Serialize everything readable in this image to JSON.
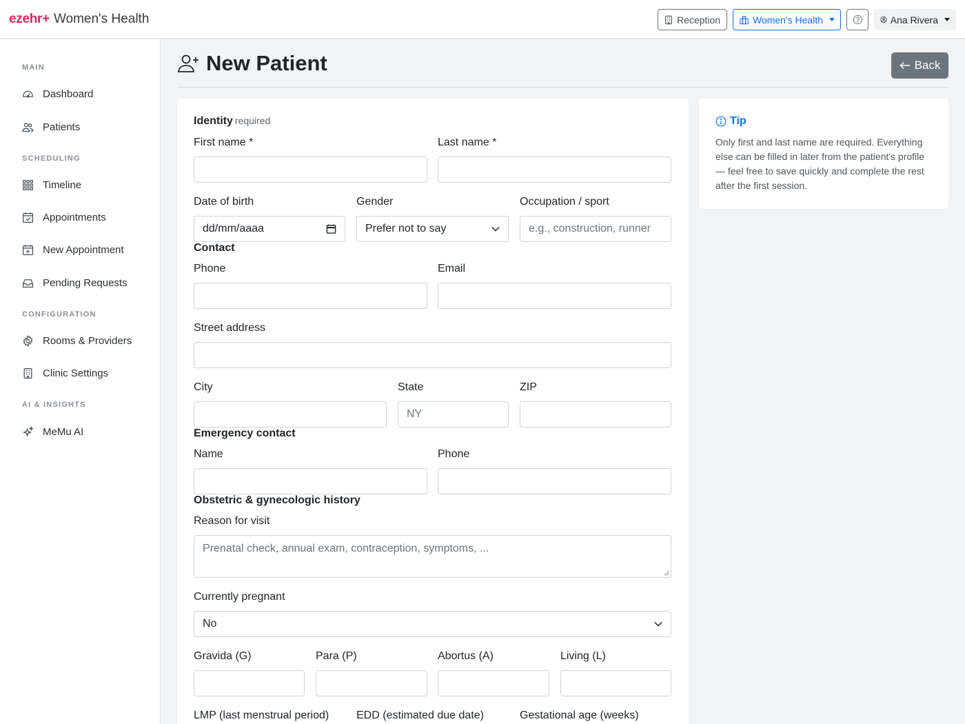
{
  "brand": {
    "logo": "ezehr+",
    "clinic": "Women's Health"
  },
  "topbar": {
    "reception": "Reception",
    "clinic_switch": "Women's Health",
    "user": "Ana Rivera"
  },
  "sidebar": {
    "sections": [
      {
        "label": "MAIN",
        "items": [
          {
            "label": "Dashboard",
            "icon": "gauge-icon"
          },
          {
            "label": "Patients",
            "icon": "people-icon"
          }
        ]
      },
      {
        "label": "SCHEDULING",
        "items": [
          {
            "label": "Timeline",
            "icon": "grid-icon"
          },
          {
            "label": "Appointments",
            "icon": "calendar-check-icon"
          },
          {
            "label": "New Appointment",
            "icon": "calendar-plus-icon"
          },
          {
            "label": "Pending Requests",
            "icon": "inbox-icon"
          }
        ]
      },
      {
        "label": "CONFIGURATION",
        "items": [
          {
            "label": "Rooms & Providers",
            "icon": "gear-icon"
          },
          {
            "label": "Clinic Settings",
            "icon": "building-icon"
          }
        ]
      },
      {
        "label": "AI & INSIGHTS",
        "items": [
          {
            "label": "MeMu AI",
            "icon": "sparkles-icon"
          }
        ]
      }
    ]
  },
  "page": {
    "title": "New Patient",
    "back": "Back"
  },
  "form": {
    "identity": {
      "title": "Identity",
      "hint": "required",
      "first_name": "First name *",
      "last_name": "Last name *",
      "dob": "Date of birth",
      "dob_value": "dd/mm/aaaa",
      "gender": "Gender",
      "gender_value": "Prefer not to say",
      "occupation": "Occupation / sport",
      "occupation_placeholder": "e.g., construction, runner"
    },
    "contact": {
      "title": "Contact",
      "phone": "Phone",
      "email": "Email",
      "street": "Street address",
      "city": "City",
      "state": "State",
      "state_value": "NY",
      "zip": "ZIP"
    },
    "emergency": {
      "title": "Emergency contact",
      "name": "Name",
      "phone": "Phone"
    },
    "obgyn": {
      "title": "Obstetric & gynecologic history",
      "reason": "Reason for visit",
      "reason_placeholder": "Prenatal check, annual exam, contraception, symptoms, ...",
      "pregnant": "Currently pregnant",
      "pregnant_value": "No",
      "gravida": "Gravida (G)",
      "para": "Para (P)",
      "abortus": "Abortus (A)",
      "living": "Living (L)",
      "lmp": "LMP (last menstrual period)",
      "edd": "EDD (estimated due date)",
      "ga": "Gestational age (weeks)"
    }
  },
  "tip": {
    "title": "Tip",
    "text": "Only first and last name are required. Everything else can be filled in later from the patient's profile — feel free to save quickly and complete the rest after the first session."
  },
  "colors": {
    "brand": "#e0245e",
    "primary": "#0d6efd",
    "secondary": "#6c757d"
  }
}
